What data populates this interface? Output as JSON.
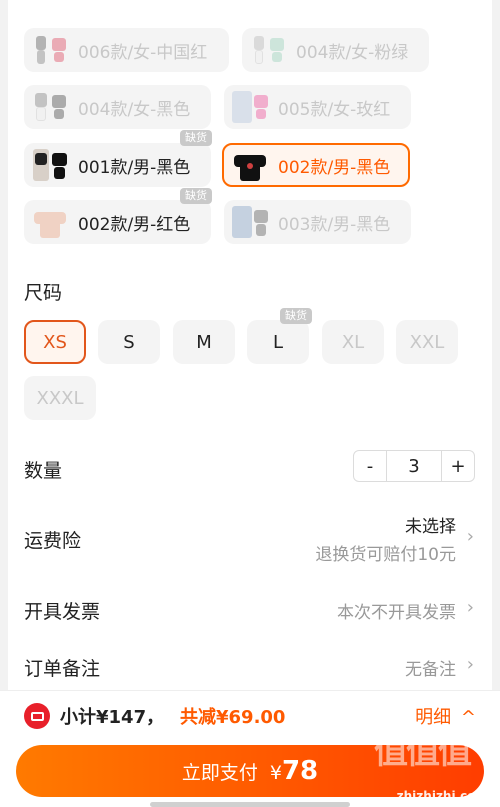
{
  "colors": {
    "accent": "#ff5a00",
    "pay_gradient_start": "#ff7a00",
    "pay_gradient_end": "#ff3d00",
    "coupon_red": "#e8202a"
  },
  "variants": [
    {
      "label": "006款/女-中国红",
      "state": "disabled"
    },
    {
      "label": "004款/女-粉绿",
      "state": "disabled"
    },
    {
      "label": "004款/女-黑色",
      "state": "disabled"
    },
    {
      "label": "005款/女-玫红",
      "state": "disabled"
    },
    {
      "label": "001款/男-黑色",
      "state": "normal",
      "tag": "缺货"
    },
    {
      "label": "002款/男-黑色",
      "state": "selected"
    },
    {
      "label": "002款/男-红色",
      "state": "normal",
      "tag": "缺货"
    },
    {
      "label": "003款/男-黑色",
      "state": "disabled"
    }
  ],
  "size_section": {
    "title": "尺码",
    "options": [
      {
        "label": "XS",
        "state": "selected"
      },
      {
        "label": "S",
        "state": "normal"
      },
      {
        "label": "M",
        "state": "normal"
      },
      {
        "label": "L",
        "state": "normal",
        "tag": "缺货"
      },
      {
        "label": "XL",
        "state": "disabled"
      },
      {
        "label": "XXL",
        "state": "disabled"
      },
      {
        "label": "XXXL",
        "state": "disabled"
      }
    ]
  },
  "quantity": {
    "label": "数量",
    "minus": "-",
    "value": "3",
    "plus": "+"
  },
  "shipping_insurance": {
    "label": "运费险",
    "value": "未选择",
    "sub": "退换货可赔付10元"
  },
  "invoice": {
    "label": "开具发票",
    "value": "本次不开具发票"
  },
  "order_note": {
    "label": "订单备注",
    "value": "无备注"
  },
  "bottom_bar": {
    "subtotal": "小计¥147，",
    "saved": "共减¥69.00",
    "detail": "明细",
    "pay_label": "立即支付",
    "pay_currency": "¥",
    "pay_amount": "78",
    "watermark_glyphs": "值值值",
    "watermark_site": "zhizhizhi.com"
  },
  "icons": {
    "chevron": "›",
    "chevron_up": "^"
  }
}
